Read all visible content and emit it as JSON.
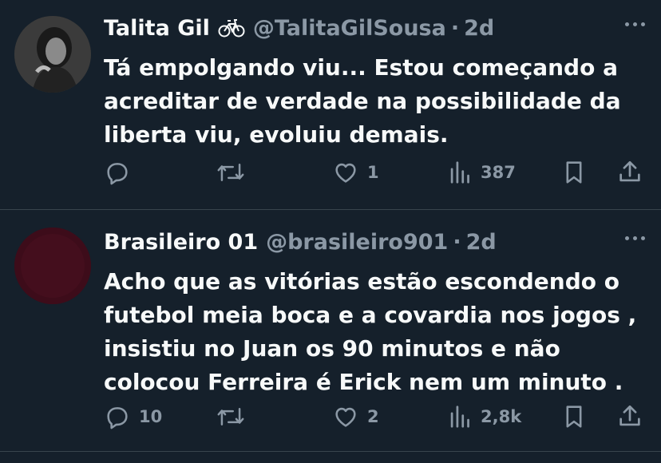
{
  "tweets": [
    {
      "name": "Talita Gil",
      "handle": "@TalitaGilSousa",
      "separator": "·",
      "time": "2d",
      "badge_icon": "bicycle-icon",
      "text": "Tá empolgando viu... Estou começando a\nacreditar de verdade na possibilidade da\nliberta viu, evoluiu demais.",
      "replies": "",
      "retweets": "",
      "likes": "1",
      "views": "387"
    },
    {
      "name": "Brasileiro 01",
      "handle": "@brasileiro901",
      "separator": "·",
      "time": "2d",
      "text": "Acho que as vitórias estão escondendo o\nfutebol meia boca e a covardia nos jogos ,\ninsistiu no Juan os 90 minutos e não\ncolocou Ferreira é Erick nem um minuto .",
      "replies": "10",
      "retweets": "",
      "likes": "2",
      "views": "2,8k"
    }
  ],
  "colors": {
    "background": "#15202b",
    "text": "#f7f9f9",
    "secondary": "#8b98a5",
    "divider": "#38444d"
  }
}
